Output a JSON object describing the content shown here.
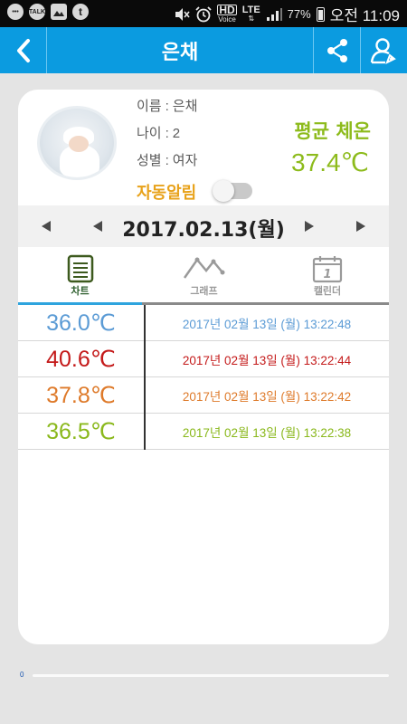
{
  "status_bar": {
    "left_icons": [
      "message-icon",
      "talk-icon",
      "gallery-icon",
      "t-icon"
    ],
    "talk_text": "TALK",
    "t_text": "t",
    "hd_text": "HD",
    "voice_text": "Voice",
    "lte_text": "LTE",
    "battery": "77%",
    "time": "오전 11:09"
  },
  "app_bar": {
    "title": "은채",
    "back_icon": "chevron-left-icon",
    "share_icon": "share-icon",
    "profile_icon": "user-settings-icon"
  },
  "profile": {
    "name_label": "이름",
    "name_value": "은채",
    "age_label": "나이",
    "age_value": "2",
    "gender_label": "성별",
    "gender_value": "여자",
    "separator": ":",
    "avg_label": "평균 체온",
    "avg_value": "37.4℃",
    "auto_alert_label": "자동알림",
    "auto_alert_on": false
  },
  "date_nav": {
    "date": "2017.02.13(월)"
  },
  "tabs": [
    {
      "label": "차트",
      "icon": "document-icon",
      "active": true
    },
    {
      "label": "그래프",
      "icon": "graph-icon",
      "active": false
    },
    {
      "label": "캘린더",
      "icon": "calendar-icon",
      "active": false
    }
  ],
  "calendar_day": "1",
  "records": [
    {
      "temp": "36.0℃",
      "timestamp": "2017년 02월 13일 (월) 13:22:48",
      "color": "#5b9bd5"
    },
    {
      "temp": "40.6℃",
      "timestamp": "2017년 02월 13일 (월) 13:22:44",
      "color": "#c41a1a"
    },
    {
      "temp": "37.8℃",
      "timestamp": "2017년 02월 13일 (월) 13:22:42",
      "color": "#de7a2a"
    },
    {
      "temp": "36.5℃",
      "timestamp": "2017년 02월 13일 (월) 13:22:38",
      "color": "#8ab81c"
    }
  ],
  "progress": {
    "label": "0",
    "value": 0
  },
  "colors": {
    "accent": "#0b9be0",
    "avg_temp": "#8dbb1c",
    "auto_alert": "#e8a21a"
  }
}
